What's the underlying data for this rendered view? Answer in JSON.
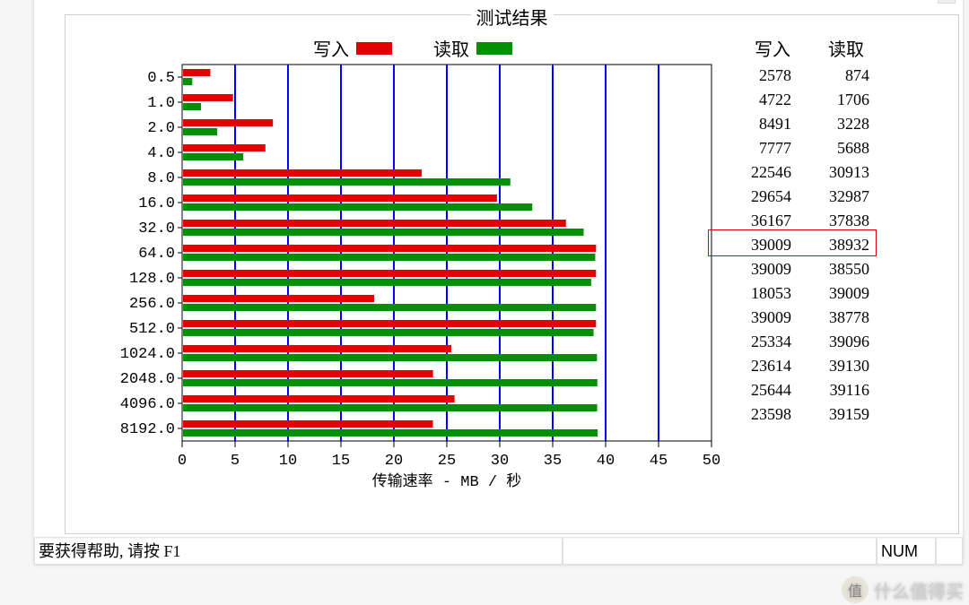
{
  "group_title": "测试结果",
  "legend": {
    "write": "写入",
    "read": "读取"
  },
  "table_header": {
    "write": "写入",
    "read": "读取"
  },
  "status": {
    "help_text": "要获得帮助, 请按 F1",
    "num_indicator": "NUM"
  },
  "axis": {
    "xlabel": "传输速率 - MB / 秒"
  },
  "colors": {
    "write": "#e20000",
    "read": "#009000",
    "grid": "#0000ff",
    "highlight": "#e20000"
  },
  "highlight_row_index": 7,
  "watermark_text": "什么值得买",
  "chart_data": {
    "type": "bar",
    "title": "测试结果",
    "xlabel": "传输速率 - MB / 秒",
    "ylabel": "",
    "xlim": [
      0,
      50
    ],
    "xticks": [
      0,
      5,
      10,
      15,
      20,
      25,
      30,
      35,
      40,
      45,
      50
    ],
    "categories": [
      "0.5",
      "1.0",
      "2.0",
      "4.0",
      "8.0",
      "16.0",
      "32.0",
      "64.0",
      "128.0",
      "256.0",
      "512.0",
      "1024.0",
      "2048.0",
      "4096.0",
      "8192.0"
    ],
    "series": [
      {
        "name": "写入",
        "color": "#e20000",
        "values": [
          2.578,
          4.722,
          8.491,
          7.777,
          22.546,
          29.654,
          36.167,
          39.009,
          39.009,
          18.053,
          39.009,
          25.334,
          23.614,
          25.644,
          23.598
        ],
        "raw": [
          2578,
          4722,
          8491,
          7777,
          22546,
          29654,
          36167,
          39009,
          39009,
          18053,
          39009,
          25334,
          23614,
          25644,
          23598
        ]
      },
      {
        "name": "读取",
        "color": "#009000",
        "values": [
          0.874,
          1.706,
          3.228,
          5.688,
          30.913,
          32.987,
          37.838,
          38.932,
          38.55,
          39.009,
          38.778,
          39.096,
          39.13,
          39.116,
          39.159
        ],
        "raw": [
          874,
          1706,
          3228,
          5688,
          30913,
          32987,
          37838,
          38932,
          38550,
          39009,
          38778,
          39096,
          39130,
          39116,
          39159
        ]
      }
    ]
  }
}
